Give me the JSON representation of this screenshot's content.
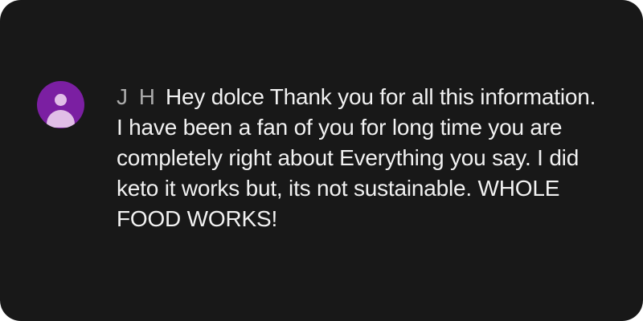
{
  "comment": {
    "author": "J H",
    "text": "Hey dolce Thank you for all this information. I have been a fan of you for long time you are completely right about Everything you say. I did keto it works but, its not sustainable. WHOLE FOOD WORKS!",
    "avatar_icon": "person-icon"
  },
  "colors": {
    "background": "#181818",
    "avatar": "#7b1fa2",
    "avatar_figure": "#e1bee7",
    "author_text": "#aaaaaa",
    "body_text": "#f1f1f1"
  }
}
